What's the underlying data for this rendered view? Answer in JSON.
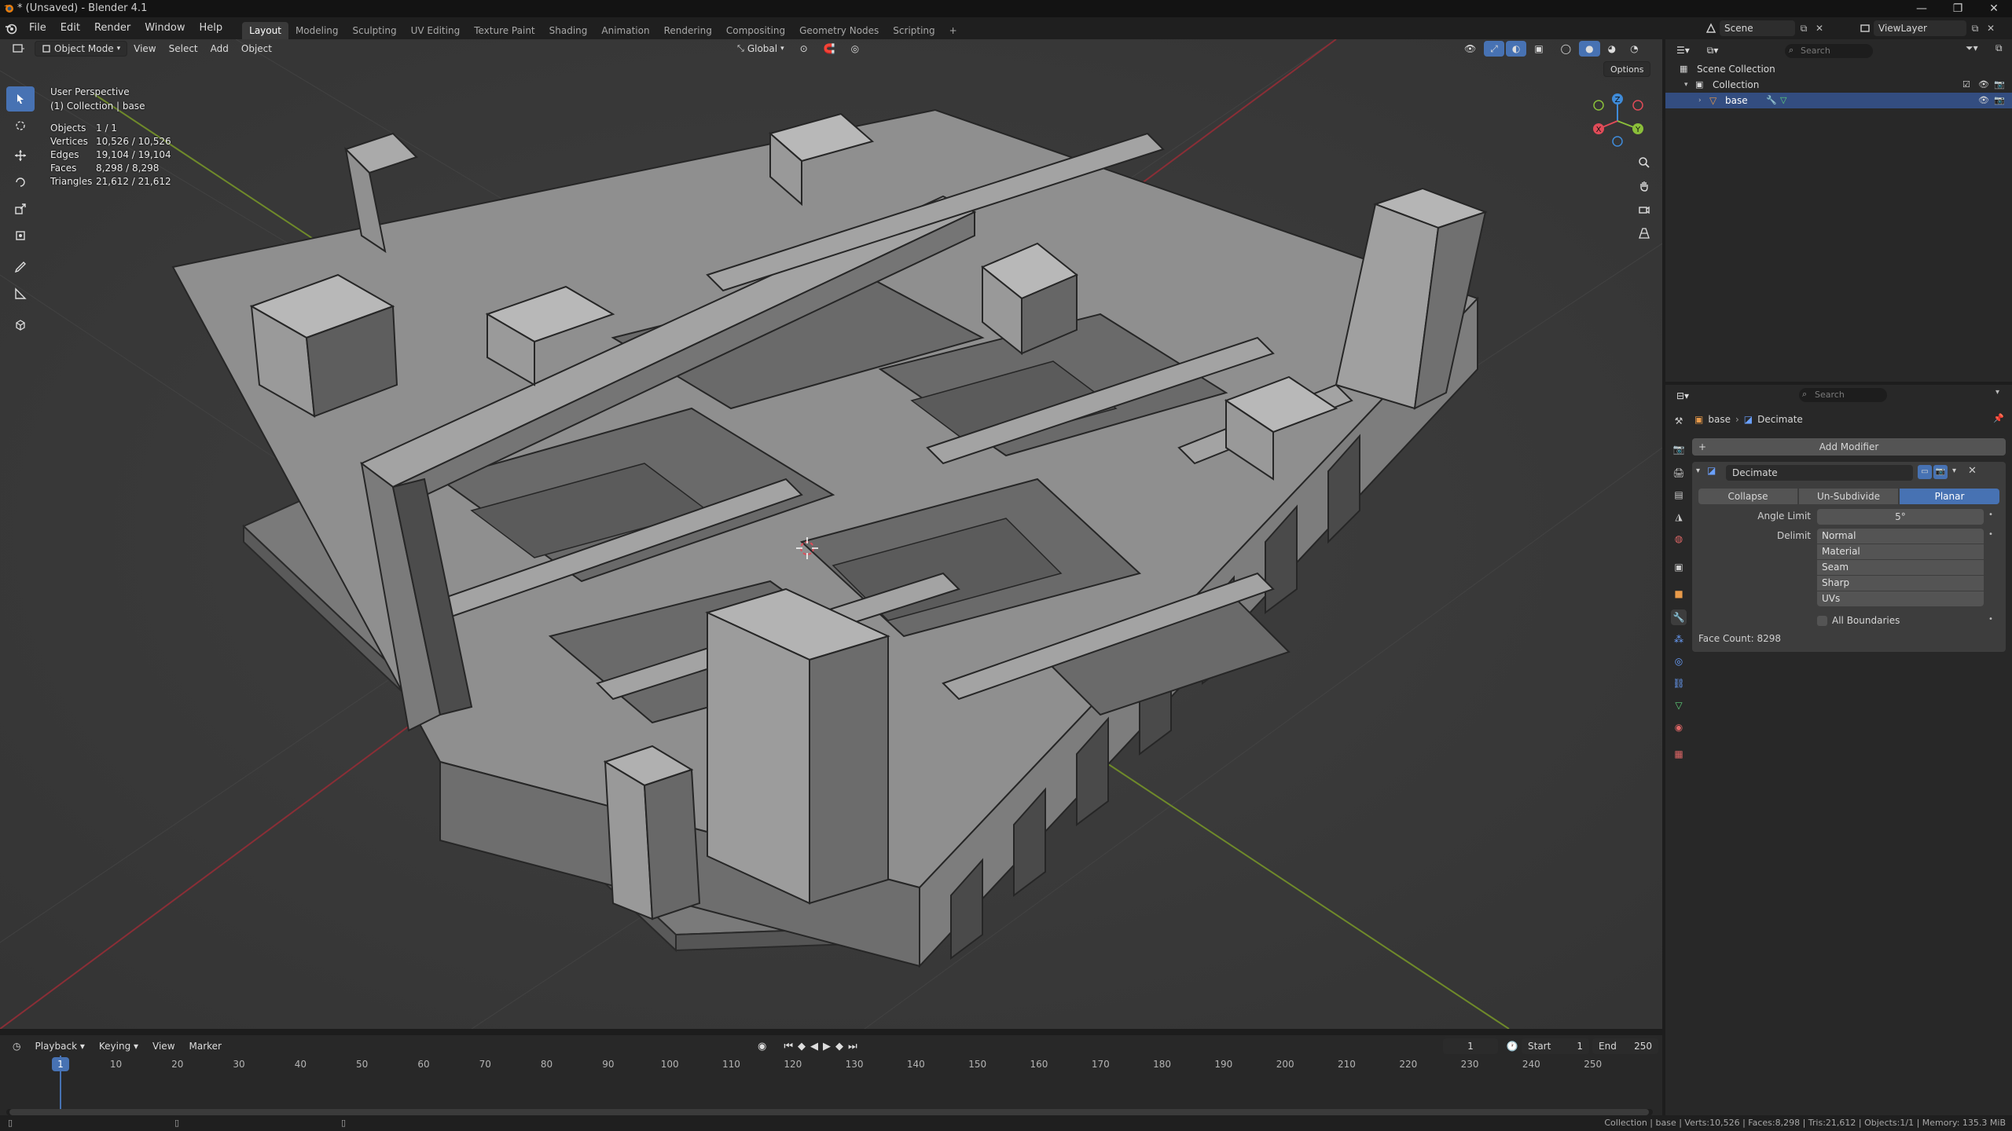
{
  "window": {
    "title": "* (Unsaved) - Blender 4.1",
    "controls": [
      "—",
      "❐",
      "✕"
    ]
  },
  "menu": {
    "items": [
      "File",
      "Edit",
      "Render",
      "Window",
      "Help"
    ]
  },
  "workspaces": {
    "tabs": [
      "Layout",
      "Modeling",
      "Sculpting",
      "UV Editing",
      "Texture Paint",
      "Shading",
      "Animation",
      "Rendering",
      "Compositing",
      "Geometry Nodes",
      "Scripting"
    ],
    "active": "Layout",
    "add": "+"
  },
  "top_right": {
    "scene": "Scene",
    "view_layer": "ViewLayer"
  },
  "viewport": {
    "mode": "Object Mode",
    "menus": [
      "View",
      "Select",
      "Add",
      "Object"
    ],
    "transform_orientation": "Global",
    "options_label": "Options",
    "perspective": "User Perspective",
    "collection_info": "(1) Collection | base",
    "stats": [
      {
        "label": "Objects",
        "value": "1 / 1"
      },
      {
        "label": "Vertices",
        "value": "10,526 / 10,526"
      },
      {
        "label": "Edges",
        "value": "19,104 / 19,104"
      },
      {
        "label": "Faces",
        "value": "8,298 / 8,298"
      },
      {
        "label": "Triangles",
        "value": "21,612 / 21,612"
      }
    ],
    "gizmo": {
      "x": "X",
      "y": "Y",
      "z": "Z"
    }
  },
  "timeline": {
    "menus": [
      "Playback",
      "Keying",
      "View",
      "Marker"
    ],
    "current_frame": "1",
    "start_label": "Start",
    "start": "1",
    "end_label": "End",
    "end": "250",
    "ticks": [
      "1",
      "10",
      "20",
      "30",
      "40",
      "50",
      "60",
      "70",
      "80",
      "90",
      "100",
      "110",
      "120",
      "130",
      "140",
      "150",
      "160",
      "170",
      "180",
      "190",
      "200",
      "210",
      "220",
      "230",
      "240",
      "250"
    ]
  },
  "outliner": {
    "search_placeholder": "Search",
    "scene_collection": "Scene Collection",
    "collection": "Collection",
    "object": "base"
  },
  "properties": {
    "search_placeholder": "Search",
    "breadcrumb": {
      "object": "base",
      "modifier": "Decimate"
    },
    "add_modifier": "Add Modifier",
    "modifier_name": "Decimate",
    "modes": [
      "Collapse",
      "Un-Subdivide",
      "Planar"
    ],
    "active_mode": "Planar",
    "angle_limit_label": "Angle Limit",
    "angle_limit_value": "5°",
    "delimit_label": "Delimit",
    "delimit_options": [
      "Normal",
      "Material",
      "Seam",
      "Sharp",
      "UVs"
    ],
    "all_boundaries": "All Boundaries",
    "face_count": "Face Count: 8298"
  },
  "statusbar": {
    "text": "Collection | base | Verts:10,526 | Faces:8,298 | Tris:21,612 | Objects:1/1 | Memory: 135.3 MiB"
  },
  "colors": {
    "accent": "#4772b3",
    "x_axis": "#e04b58",
    "y_axis": "#8bbf3a",
    "z_axis": "#3f8bd9",
    "mesh": "#9a9a9a"
  }
}
